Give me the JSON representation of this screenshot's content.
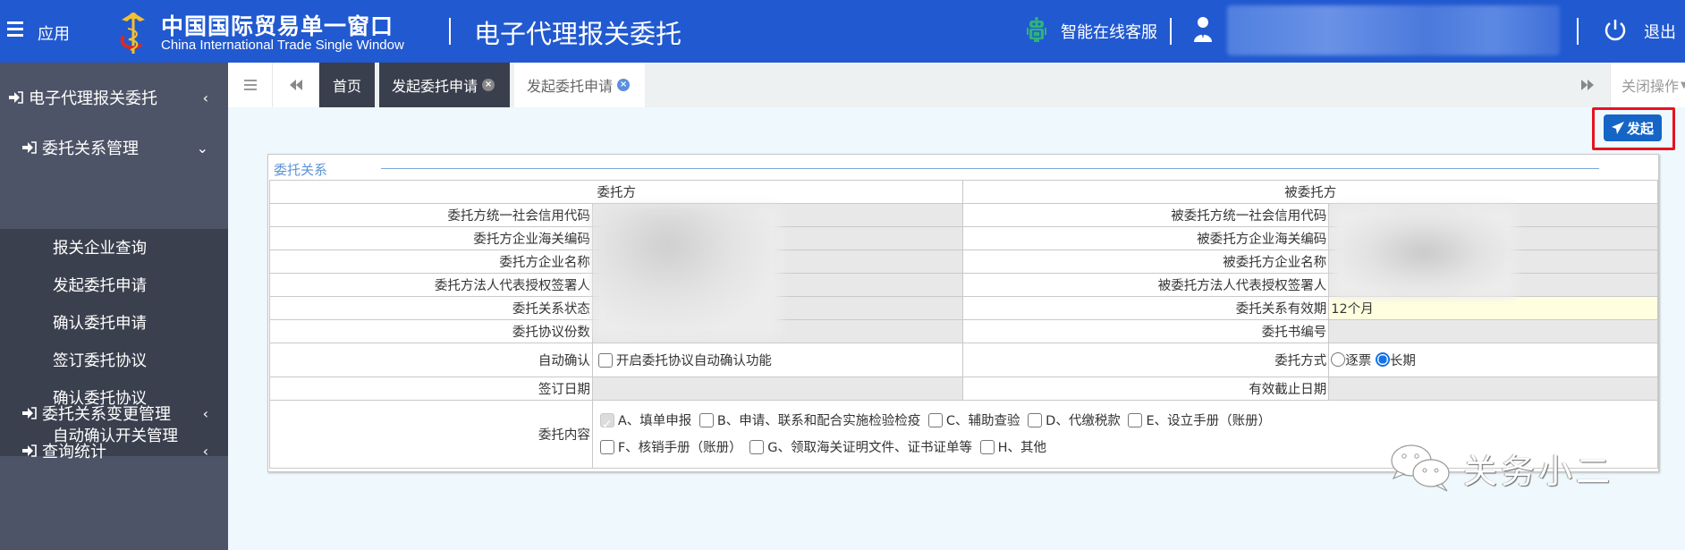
{
  "header": {
    "app_label": "应用",
    "brand_cn": "中国国际贸易单一窗口",
    "brand_en": "China International Trade Single Window",
    "system_title": "电子代理报关委托",
    "service_label": "智能在线客服",
    "logout_label": "退出",
    "colors": {
      "bar": "#2159d0",
      "robot": "#2cb37a"
    }
  },
  "sidebar": {
    "root": {
      "label": "电子代理报关委托",
      "chevron": "‹"
    },
    "groups": [
      {
        "label": "委托关系管理",
        "chevron": "⌄",
        "expanded": true,
        "items": [
          "报关企业查询",
          "发起委托申请",
          "确认委托申请",
          "签订委托协议",
          "确认委托协议",
          "自动确认开关管理"
        ]
      },
      {
        "label": "委托关系变更管理",
        "chevron": "‹",
        "expanded": false
      },
      {
        "label": "查询统计",
        "chevron": "‹",
        "expanded": false
      }
    ]
  },
  "tabs": {
    "items": [
      {
        "label": "首页",
        "closable": false,
        "active": false
      },
      {
        "label": "发起委托申请",
        "closable": true,
        "active": false
      },
      {
        "label": "发起委托申请",
        "closable": true,
        "active": true
      }
    ],
    "close_ops_label": "关闭操作",
    "close_glyph": "×"
  },
  "toolbar": {
    "launch_label": "发起"
  },
  "panel": {
    "legend": "委托关系",
    "principal_header": "委托方",
    "agent_header": "被委托方",
    "left_rows": [
      {
        "label": "委托方统一社会信用代码",
        "value": ""
      },
      {
        "label": "委托方企业海关编码",
        "value": ""
      },
      {
        "label": "委托方企业名称",
        "value": ""
      },
      {
        "label": "委托方法人代表授权签署人",
        "value": ""
      },
      {
        "label": "委托关系状态",
        "value": ""
      },
      {
        "label": "委托协议份数",
        "value": ""
      }
    ],
    "right_rows": [
      {
        "label": "被委托方统一社会信用代码",
        "value": ""
      },
      {
        "label": "被委托方企业海关编码",
        "value": ""
      },
      {
        "label": "被委托方企业名称",
        "value": ""
      },
      {
        "label": "被委托方法人代表授权签署人",
        "value": ""
      },
      {
        "label": "委托关系有效期",
        "value": "12个月"
      },
      {
        "label": "委托书编号",
        "value": ""
      }
    ],
    "auto_confirm": {
      "label": "自动确认",
      "checkbox_label": "开启委托协议自动确认功能",
      "checked": false
    },
    "mode": {
      "label": "委托方式",
      "options": [
        {
          "label": "逐票",
          "selected": false
        },
        {
          "label": "长期",
          "selected": true
        }
      ]
    },
    "sign_date": {
      "label": "签订日期",
      "value": ""
    },
    "expiry_date": {
      "label": "有效截止日期",
      "value": ""
    },
    "content": {
      "label": "委托内容",
      "options": [
        {
          "label": "A、填单申报",
          "checked": true,
          "disabled": true
        },
        {
          "label": "B、申请、联系和配合实施检验检疫",
          "checked": false
        },
        {
          "label": "C、辅助查验",
          "checked": false
        },
        {
          "label": "D、代缴税款",
          "checked": false
        },
        {
          "label": "E、设立手册（账册）",
          "checked": false
        },
        {
          "label": "F、核销手册（账册）",
          "checked": false
        },
        {
          "label": "G、领取海关证明文件、证书证单等",
          "checked": false
        },
        {
          "label": "H、其他",
          "checked": false
        }
      ]
    }
  },
  "watermark": {
    "text": "关务小二"
  }
}
